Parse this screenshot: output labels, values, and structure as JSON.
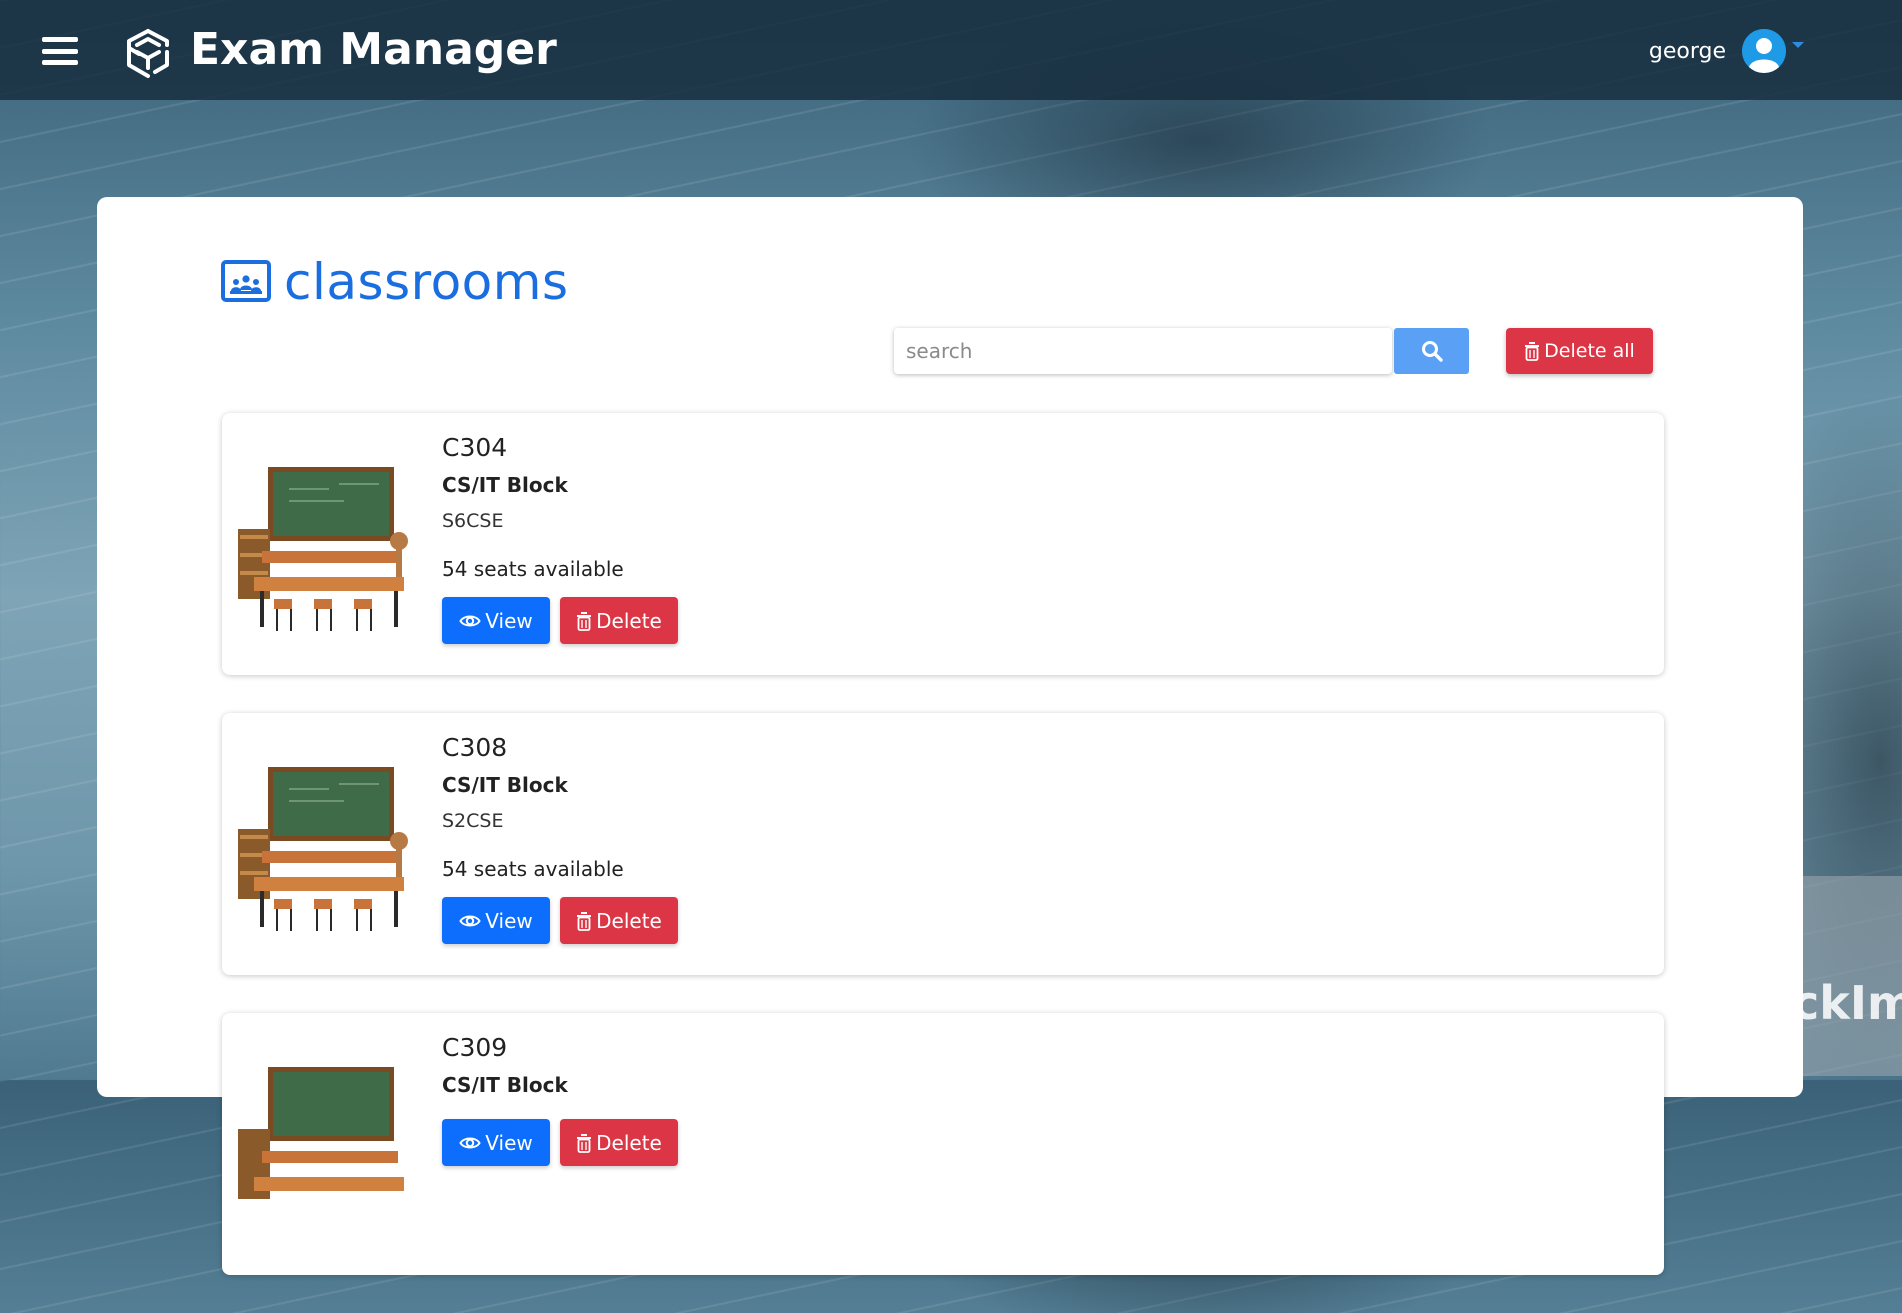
{
  "app": {
    "title": "Exam Manager"
  },
  "user": {
    "name": "george"
  },
  "page": {
    "heading": "classrooms"
  },
  "search": {
    "placeholder": "search",
    "value": ""
  },
  "actions": {
    "delete_all_label": "Delete all"
  },
  "classrooms": [
    {
      "name": "C304",
      "block": "CS/IT Block",
      "section": "S6CSE",
      "seats": "54 seats available",
      "view_label": "View",
      "delete_label": "Delete"
    },
    {
      "name": "C308",
      "block": "CS/IT Block",
      "section": "S2CSE",
      "seats": "54 seats available",
      "view_label": "View",
      "delete_label": "Delete"
    },
    {
      "name": "C309",
      "block": "CS/IT Block",
      "section": "",
      "seats": "",
      "view_label": "View",
      "delete_label": "Delete"
    }
  ],
  "watermark": {
    "text": "ckIm"
  },
  "colors": {
    "brand_blue": "#1a6ee0",
    "view_button": "#0d6efd",
    "delete_button": "#dc3545",
    "search_button": "#5aa0f5",
    "topbar": "#162c3c"
  },
  "icons": {
    "menu": "hamburger-icon",
    "logo": "cube-logo-icon",
    "avatar": "user-avatar-icon",
    "heading": "classroom-icon",
    "search": "search-icon",
    "delete": "trash-icon",
    "view": "eye-icon"
  }
}
